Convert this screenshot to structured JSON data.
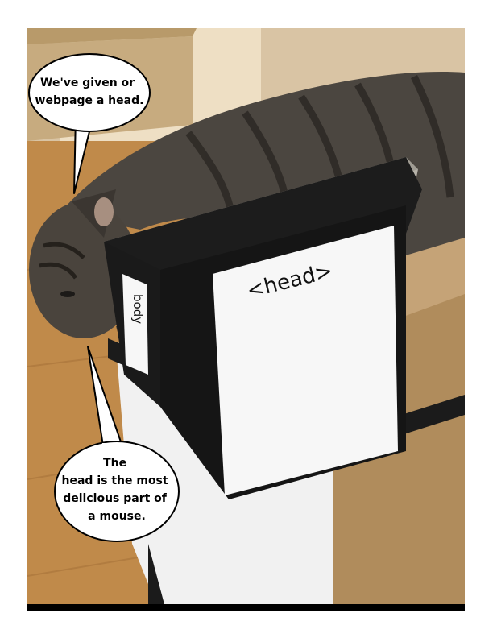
{
  "bubble_top": {
    "line1": "We've given or",
    "line2": "webpage a head."
  },
  "bubble_bottom": {
    "line1": "The",
    "line2": "head is the most",
    "line3": "delicious part of",
    "line4": "a mouse."
  },
  "box_sign_front": "<head>",
  "box_sign_side": "body",
  "colors": {
    "frame": "#000000",
    "floor": "#c08a4a",
    "wall": "#e8d7be",
    "cardboard": "#c9a97c",
    "tape": "#1b1b1b",
    "paper": "#f7f7f7",
    "cat_fur": "#4b4640"
  }
}
